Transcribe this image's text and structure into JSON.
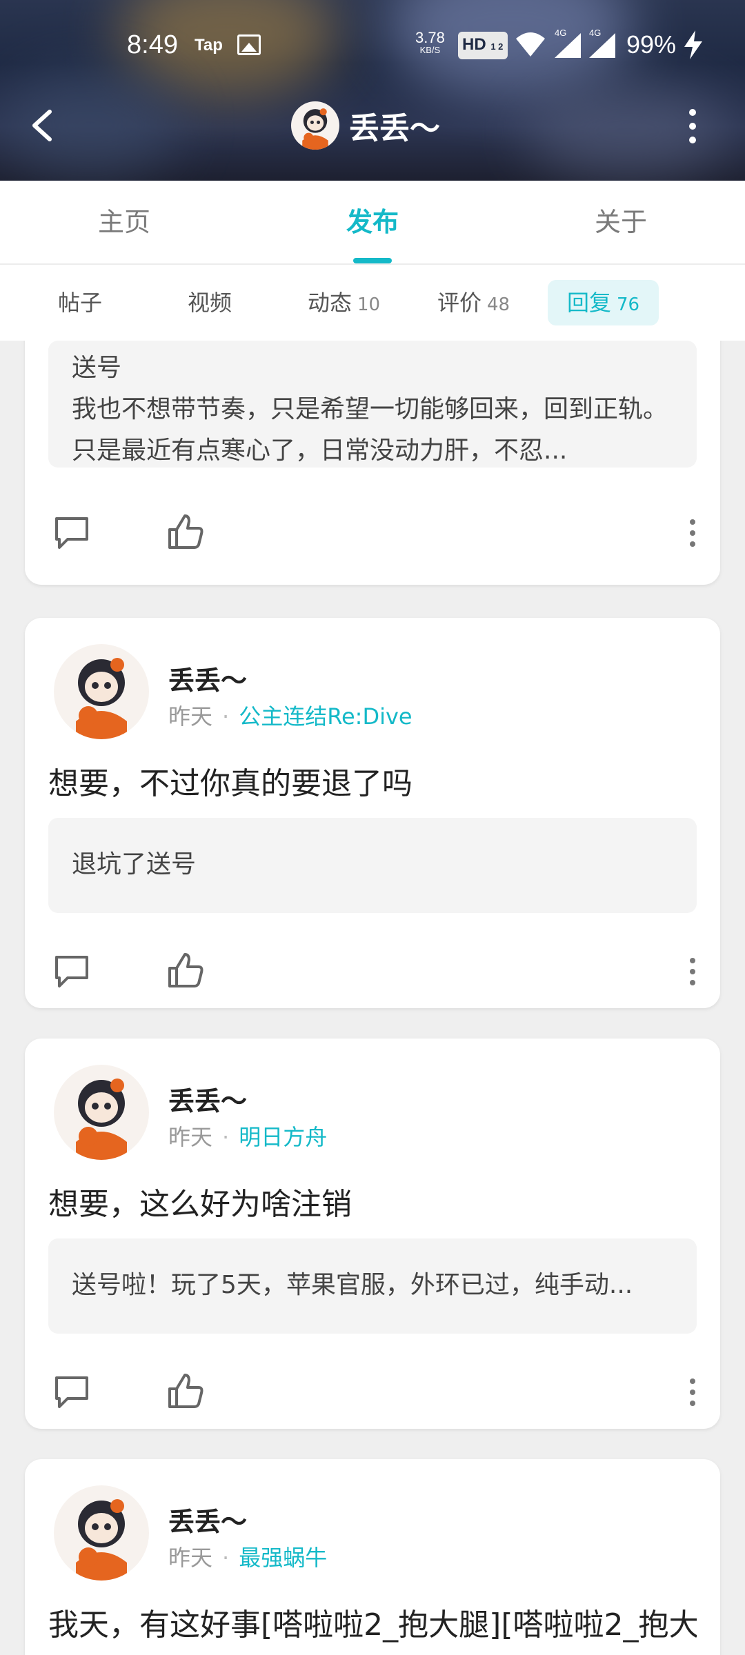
{
  "status_bar": {
    "time": "8:49",
    "app_badge": "Tap",
    "speed_value": "3.78",
    "speed_unit": "KB/S",
    "hd_label": "HD",
    "hd_sub": "1 2",
    "signal1_label": "4G",
    "signal2_label": "4G",
    "battery": "99%"
  },
  "header": {
    "title": "丢丢〜"
  },
  "tabs": [
    "主页",
    "发布",
    "关于"
  ],
  "active_tab": "发布",
  "subtabs": [
    {
      "label": "帖子",
      "count": ""
    },
    {
      "label": "视频",
      "count": ""
    },
    {
      "label": "动态",
      "count": "10"
    },
    {
      "label": "评价",
      "count": "48"
    },
    {
      "label": "回复",
      "count": "76"
    }
  ],
  "posts": [
    {
      "quote_title": "送号",
      "quote_body": "我也不想带节奏，只是希望一切能够回来，回到正轨。 只是最近有点寒心了，日常没动力肝，不忍..."
    },
    {
      "user": "丢丢〜",
      "time": "昨天",
      "game": "公主连结Re:Dive",
      "content": "想要，不过你真的要退了吗",
      "quote": "退坑了送号"
    },
    {
      "user": "丢丢〜",
      "time": "昨天",
      "game": "明日方舟",
      "content": "想要，这么好为啥注销",
      "quote": "送号啦！玩了5天，苹果官服，外环已过，纯手动..."
    },
    {
      "user": "丢丢〜",
      "time": "昨天",
      "game": "最强蜗牛",
      "content": "我天，有这好事[嗒啦啦2_抱大腿][嗒啦啦2_抱大"
    }
  ],
  "colors": {
    "accent": "#14b9c8",
    "header_bg": "#1f2a44"
  }
}
